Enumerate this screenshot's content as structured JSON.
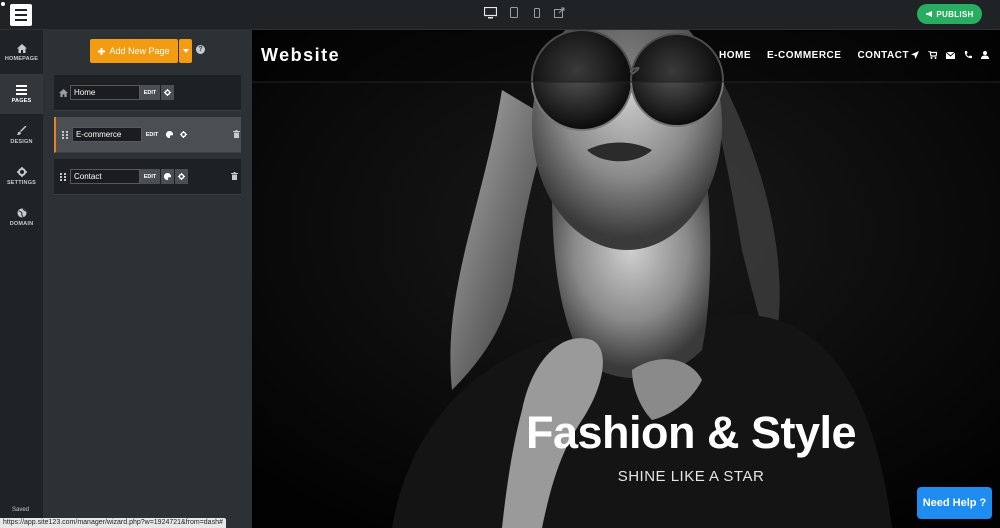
{
  "topbar": {
    "devices": [
      "desktop-icon",
      "tablet-icon",
      "mobile-icon",
      "external-link-icon"
    ],
    "publish_label": "PUBLISH"
  },
  "rail": {
    "items": [
      {
        "label": "HOMEPAGE",
        "icon": "home-icon"
      },
      {
        "label": "PAGES",
        "icon": "pages-icon"
      },
      {
        "label": "DESIGN",
        "icon": "brush-icon"
      },
      {
        "label": "SETTINGS",
        "icon": "gear-icon"
      },
      {
        "label": "DOMAIN",
        "icon": "globe-icon"
      }
    ],
    "active": "PAGES",
    "saved_label": "Saved"
  },
  "pages_panel": {
    "add_page_label": "Add New Page",
    "pages": [
      {
        "name": "Home",
        "edit_label": "EDIT"
      },
      {
        "name": "E-commerce",
        "edit_label": "EDIT"
      },
      {
        "name": "Contact",
        "edit_label": "EDIT"
      }
    ]
  },
  "preview": {
    "brand": "Website",
    "nav": [
      "HOME",
      "E-COMMERCE",
      "CONTACT"
    ],
    "nav_icons": [
      "location-arrow-icon",
      "cart-icon",
      "envelope-icon",
      "phone-icon",
      "user-icon"
    ],
    "hero_title": "Fashion & Style",
    "hero_subtitle": "SHINE LIKE A STAR"
  },
  "need_help_label": "Need Help ?",
  "status_url": "https://app.site123.com/manager/wizard.php?w=1924721&from=dash#",
  "colors": {
    "publish": "#27ae60",
    "add_page": "#f39c12",
    "need_help": "#1e8cf0",
    "panel": "#2c3135",
    "rail": "#202326"
  }
}
